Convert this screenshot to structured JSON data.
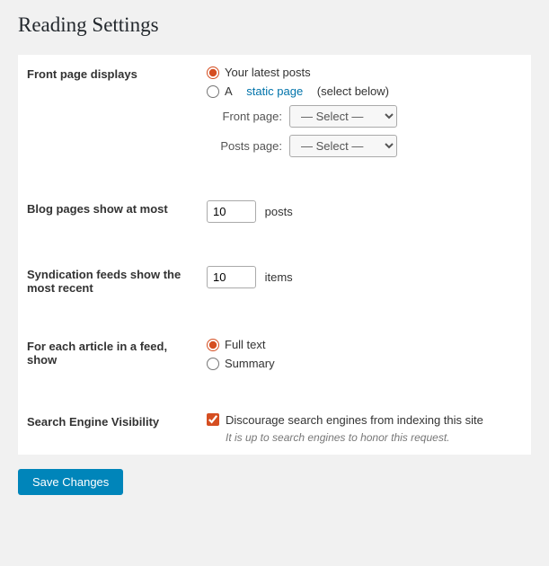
{
  "page": {
    "title": "Reading Settings"
  },
  "rows": [
    {
      "id": "front-page-displays",
      "label": "Front page displays",
      "type": "radio-group-with-subfields"
    },
    {
      "id": "blog-pages",
      "label": "Blog pages show at most",
      "type": "number-posts",
      "value": "10",
      "suffix": "posts"
    },
    {
      "id": "syndication-feeds",
      "label": "Syndication feeds show the most recent",
      "type": "number-items",
      "value": "10",
      "suffix": "items"
    },
    {
      "id": "feed-article",
      "label": "For each article in a feed, show",
      "type": "radio-feed"
    },
    {
      "id": "search-engine",
      "label": "Search Engine Visibility",
      "type": "checkbox-visibility"
    }
  ],
  "front_page": {
    "option1_label": "Your latest posts",
    "option2_label": "A",
    "option2_link_text": "static page",
    "option2_suffix": "(select below)",
    "front_page_label": "Front page:",
    "posts_page_label": "Posts page:",
    "select_placeholder": "— Select —"
  },
  "feed": {
    "full_text_label": "Full text",
    "summary_label": "Summary"
  },
  "visibility": {
    "checkbox_label": "Discourage search engines from indexing this site",
    "hint": "It is up to search engines to honor this request."
  },
  "buttons": {
    "save": "Save Changes"
  }
}
